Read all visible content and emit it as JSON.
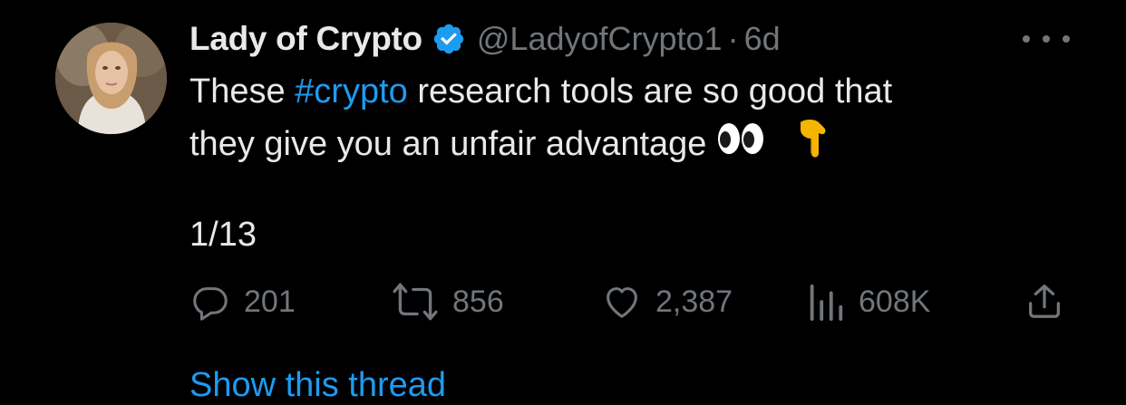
{
  "tweet": {
    "author": {
      "display_name": "Lady of Crypto",
      "handle": "@LadyofCrypto1",
      "verified": true,
      "avatar_icon": "profile-photo"
    },
    "separator": "·",
    "time": "6d",
    "more_icon": "more-horizontal-icon",
    "text": {
      "line1_before": "These ",
      "hashtag": "#crypto",
      "line1_after": " research tools are so good that",
      "line2": "they give you an unfair advantage",
      "emojis": [
        "eyes-emoji",
        "backhand-index-pointing-down-emoji"
      ]
    },
    "thread_counter": "1/13",
    "actions": {
      "replies": {
        "icon": "reply-icon",
        "count": "201"
      },
      "retweets": {
        "icon": "retweet-icon",
        "count": "856"
      },
      "likes": {
        "icon": "heart-icon",
        "count": "2,387"
      },
      "views": {
        "icon": "views-icon",
        "count": "608K"
      },
      "share": {
        "icon": "share-icon"
      }
    },
    "show_thread_label": "Show this thread"
  },
  "colors": {
    "background": "#000000",
    "primary_text": "#e7e9ea",
    "secondary_text": "#71767b",
    "accent": "#1d9bf0"
  }
}
